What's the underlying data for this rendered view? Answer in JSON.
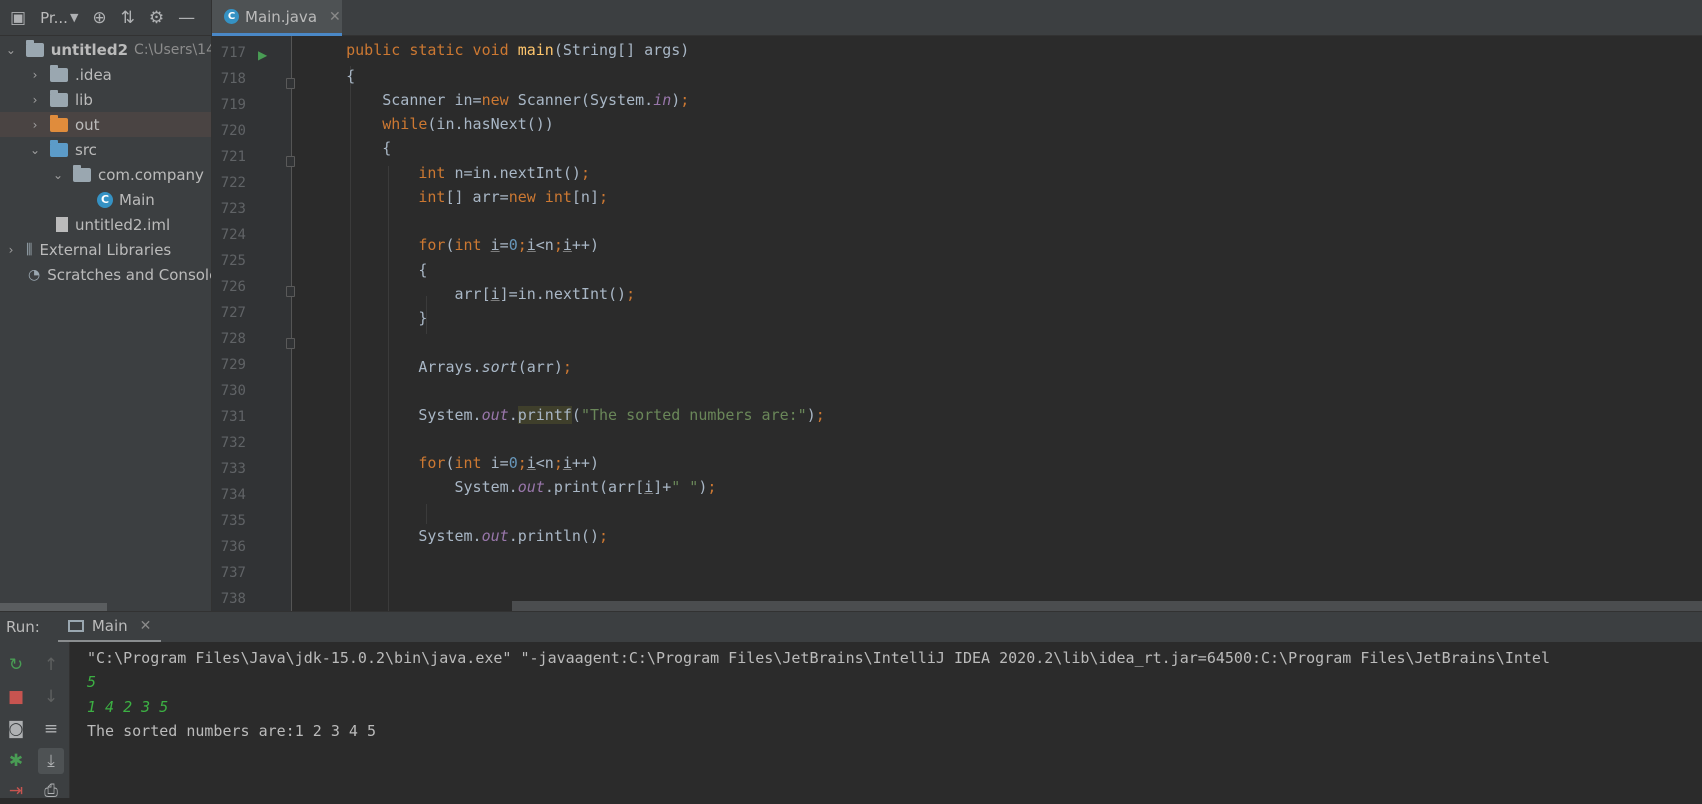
{
  "project": {
    "title": "Pr...",
    "header_icons": [
      "project-window-icon",
      "dropdown-icon",
      "locate-icon",
      "collapse-icon",
      "gear-icon",
      "minimize-icon"
    ],
    "tree": [
      {
        "label": "untitled2",
        "hint": "C:\\Users\\14",
        "kind": "module-folder",
        "expanded": true
      },
      {
        "label": ".idea",
        "kind": "folder",
        "expanded": false
      },
      {
        "label": "lib",
        "kind": "folder",
        "expanded": false
      },
      {
        "label": "out",
        "kind": "excluded-folder",
        "expanded": false
      },
      {
        "label": "src",
        "kind": "source-folder",
        "expanded": true
      },
      {
        "label": "com.company",
        "kind": "package",
        "expanded": true
      },
      {
        "label": "Main",
        "kind": "class"
      },
      {
        "label": "untitled2.iml",
        "kind": "file"
      },
      {
        "label": "External Libraries",
        "kind": "libraries",
        "expanded": false
      },
      {
        "label": "Scratches and Consoles",
        "kind": "scratches"
      }
    ]
  },
  "editor": {
    "tab_label": "Main.java",
    "line_numbers": [
      "717",
      "718",
      "719",
      "720",
      "721",
      "722",
      "723",
      "724",
      "725",
      "726",
      "727",
      "728",
      "729",
      "730",
      "731",
      "732",
      "733",
      "734",
      "735",
      "736",
      "737",
      "738"
    ]
  },
  "run": {
    "label": "Run:",
    "tab_label": "Main",
    "console_lines": [
      "\"C:\\Program Files\\Java\\jdk-15.0.2\\bin\\java.exe\" \"-javaagent:C:\\Program Files\\JetBrains\\IntelliJ IDEA 2020.2\\lib\\idea_rt.jar=64500:C:\\Program Files\\JetBrains\\Intel",
      "5",
      "1 4 2 3 5",
      "The sorted numbers are:1 2 3 4 5"
    ]
  },
  "colors": {
    "keyword": "#cc7832",
    "method": "#ffc66d",
    "static_field": "#9876aa",
    "string": "#6a8759",
    "number": "#6897bb",
    "console_input": "#3cb043"
  }
}
